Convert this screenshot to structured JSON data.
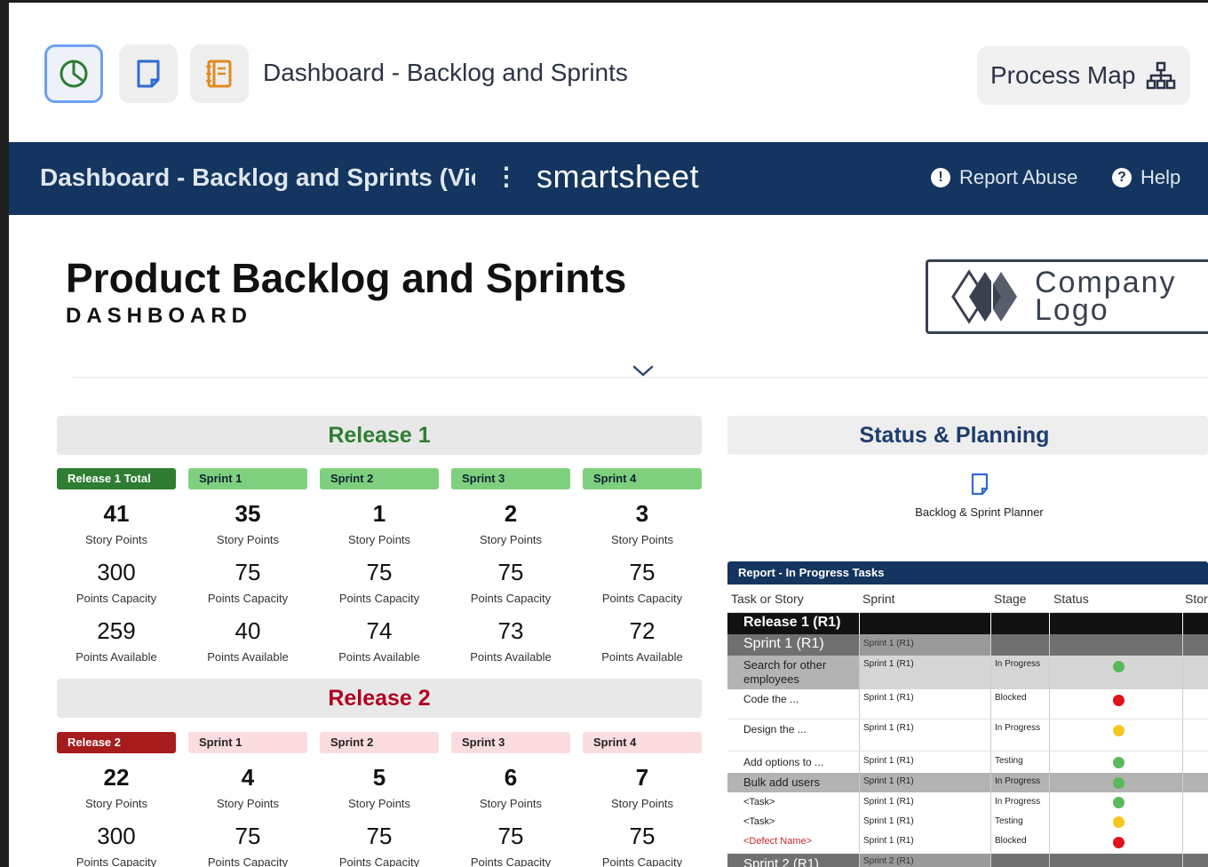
{
  "toolbar": {
    "title": "Dashboard - Backlog and Sprints",
    "process_map_label": "Process Map"
  },
  "navbar": {
    "title": "Dashboard - Backlog and Sprints (View Only)",
    "kebab": "⋮",
    "brand": "smartsheet",
    "report_abuse": "Report Abuse",
    "help": "Help"
  },
  "dashboard": {
    "title": "Product Backlog and Sprints",
    "subtitle": "DASHBOARD",
    "logo_line1": "Company",
    "logo_line2": "Logo"
  },
  "release1": {
    "header": "Release 1",
    "columns": [
      {
        "tag": "Release 1 Total",
        "story_points": "41",
        "capacity": "300",
        "available": "259"
      },
      {
        "tag": "Sprint 1",
        "story_points": "35",
        "capacity": "75",
        "available": "40"
      },
      {
        "tag": "Sprint 2",
        "story_points": "1",
        "capacity": "75",
        "available": "74"
      },
      {
        "tag": "Sprint 3",
        "story_points": "2",
        "capacity": "75",
        "available": "73"
      },
      {
        "tag": "Sprint 4",
        "story_points": "3",
        "capacity": "75",
        "available": "72"
      }
    ]
  },
  "release2": {
    "header": "Release 2",
    "columns": [
      {
        "tag": "Release 2",
        "story_points": "22",
        "capacity": "300"
      },
      {
        "tag": "Sprint 1",
        "story_points": "4",
        "capacity": "75"
      },
      {
        "tag": "Sprint 2",
        "story_points": "5",
        "capacity": "75"
      },
      {
        "tag": "Sprint 3",
        "story_points": "6",
        "capacity": "75"
      },
      {
        "tag": "Sprint 4",
        "story_points": "7",
        "capacity": "75"
      }
    ]
  },
  "labels": {
    "story_points": "Story Points",
    "capacity": "Points Capacity",
    "available": "Points Available"
  },
  "status_planning": {
    "header": "Status & Planning",
    "planner_label": "Backlog & Sprint Planner"
  },
  "report": {
    "title": "Report - In Progress Tasks",
    "columns": [
      "Task or Story",
      "Sprint",
      "Stage",
      "Status",
      "Story"
    ],
    "rows": [
      {
        "task": "Release 1 (R1)",
        "sprint": "",
        "stage": "",
        "status": ""
      },
      {
        "task": "Sprint 1 (R1)",
        "sprint": "Sprint 1 (R1)",
        "stage": "",
        "status": ""
      },
      {
        "task": "Search for other employees",
        "sprint": "Sprint 1 (R1)",
        "stage": "In Progress",
        "status": "green"
      },
      {
        "task": "Code the ...",
        "sprint": "Sprint 1 (R1)",
        "stage": "Blocked",
        "status": "red"
      },
      {
        "task": "Design the ...",
        "sprint": "Sprint 1 (R1)",
        "stage": "In Progress",
        "status": "yellow"
      },
      {
        "task": "Add options to ...",
        "sprint": "Sprint 1 (R1)",
        "stage": "Testing",
        "status": "green"
      },
      {
        "task": "Bulk add users",
        "sprint": "Sprint 1 (R1)",
        "stage": "In Progress",
        "status": "green"
      },
      {
        "task": "<Task>",
        "sprint": "Sprint 1 (R1)",
        "stage": "In Progress",
        "status": "green"
      },
      {
        "task": "<Task>",
        "sprint": "Sprint 1 (R1)",
        "stage": "Testing",
        "status": "yellow"
      },
      {
        "task": "<Defect Name>",
        "sprint": "Sprint 1 (R1)",
        "stage": "Blocked",
        "status": "red"
      },
      {
        "task": "Sprint 2 (R1)",
        "sprint": "Sprint 2 (R1)",
        "stage": "",
        "status": ""
      }
    ]
  },
  "colors": {
    "navy": "#13355f",
    "release1_green": "#2e7d32",
    "release2_red": "#b00020",
    "status_green": "#5cb85c",
    "status_red": "#e0141e",
    "status_yellow": "#f4c620"
  }
}
